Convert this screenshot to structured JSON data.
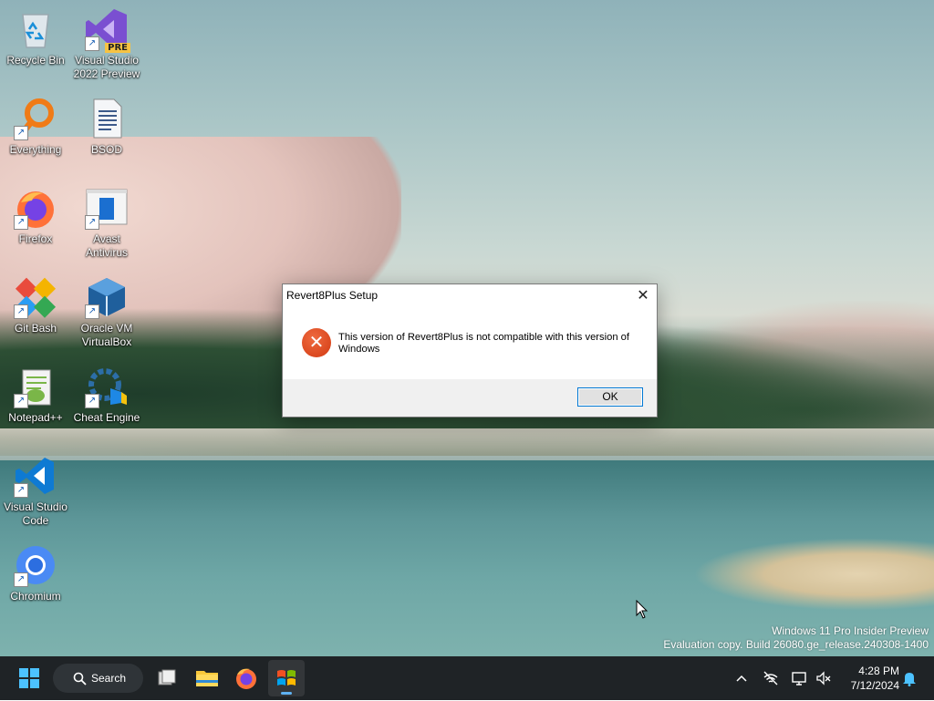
{
  "desktop_icons": [
    {
      "id": "recycle-bin",
      "label": "Recycle Bin"
    },
    {
      "id": "visual-studio-2022-preview",
      "label": "Visual Studio 2022 Preview",
      "badge": "PRE"
    },
    {
      "id": "everything",
      "label": "Everything"
    },
    {
      "id": "bsod",
      "label": "BSOD"
    },
    {
      "id": "firefox",
      "label": "Firefox"
    },
    {
      "id": "avast-antivirus",
      "label": "Avast Antivirus"
    },
    {
      "id": "git-bash",
      "label": "Git Bash"
    },
    {
      "id": "oracle-vm-virtualbox",
      "label": "Oracle VM VirtualBox"
    },
    {
      "id": "notepad-plus-plus",
      "label": "Notepad++"
    },
    {
      "id": "cheat-engine",
      "label": "Cheat Engine"
    },
    {
      "id": "visual-studio-code",
      "label": "Visual Studio Code"
    },
    {
      "id": "chromium",
      "label": "Chromium"
    }
  ],
  "dialog": {
    "title": "Revert8Plus Setup",
    "message": "This version of Revert8Plus is not compatible with this version of Windows",
    "ok_label": "OK",
    "icon": "error-icon"
  },
  "watermark": {
    "line1": "Windows 11 Pro Insider Preview",
    "line2": "Evaluation copy. Build 26080.ge_release.240308-1400"
  },
  "taskbar": {
    "search_label": "Search",
    "pinned": [
      "start-icon",
      "task-view-icon",
      "file-explorer-icon",
      "firefox-icon",
      "setup-app-icon"
    ],
    "tray": [
      "chevron-up-icon",
      "network-off-icon",
      "display-icon",
      "speaker-muted-icon",
      "bell-icon"
    ],
    "time": "4:28 PM",
    "date": "7/12/2024"
  },
  "colors": {
    "taskbar_bg": "#1f2326",
    "accent": "#0078d4",
    "error_red": "#d23a12"
  }
}
